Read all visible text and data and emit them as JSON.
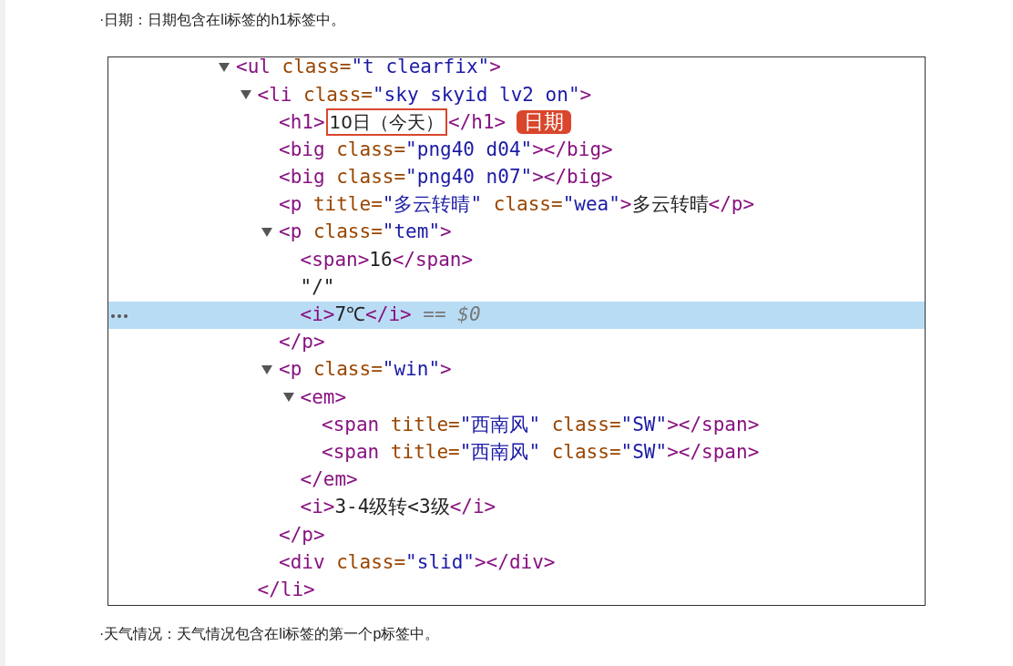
{
  "intro": "·日期：日期包含在li标签的h1标签中。",
  "tree": [
    {
      "expanded": true,
      "tokens": [
        {
          "kind": "tag",
          "text": "<ul"
        },
        {
          "kind": "attr",
          "text": " class="
        },
        {
          "kind": "value",
          "text": "\"t clearfix\""
        },
        {
          "kind": "tag",
          "text": ">"
        }
      ],
      "children": [
        {
          "expanded": true,
          "tokens": [
            {
              "kind": "tag",
              "text": "<li"
            },
            {
              "kind": "attr",
              "text": " class="
            },
            {
              "kind": "value",
              "text": "\"sky skyid lv2 on\""
            },
            {
              "kind": "tag",
              "text": ">"
            }
          ],
          "close": [
            {
              "kind": "tag",
              "text": "</li>"
            }
          ],
          "children": [
            {
              "tokens": [
                {
                  "kind": "tag",
                  "text": "<h1>"
                },
                {
                  "kind": "boxed",
                  "text": "10日（今天）"
                },
                {
                  "kind": "tag",
                  "text": "</h1>"
                },
                {
                  "kind": "badge",
                  "text": "日期"
                }
              ]
            },
            {
              "tokens": [
                {
                  "kind": "tag",
                  "text": "<big"
                },
                {
                  "kind": "attr",
                  "text": " class="
                },
                {
                  "kind": "value",
                  "text": "\"png40 d04\""
                },
                {
                  "kind": "tag",
                  "text": "></big>"
                }
              ]
            },
            {
              "tokens": [
                {
                  "kind": "tag",
                  "text": "<big"
                },
                {
                  "kind": "attr",
                  "text": " class="
                },
                {
                  "kind": "value",
                  "text": "\"png40 n07\""
                },
                {
                  "kind": "tag",
                  "text": "></big>"
                }
              ]
            },
            {
              "tokens": [
                {
                  "kind": "tag",
                  "text": "<p"
                },
                {
                  "kind": "attr",
                  "text": " title="
                },
                {
                  "kind": "value",
                  "text": "\"多云转晴\""
                },
                {
                  "kind": "attr",
                  "text": " class="
                },
                {
                  "kind": "value",
                  "text": "\"wea\""
                },
                {
                  "kind": "tag",
                  "text": ">"
                },
                {
                  "kind": "text",
                  "text": "多云转晴"
                },
                {
                  "kind": "tag",
                  "text": "</p>"
                }
              ]
            },
            {
              "expanded": true,
              "tokens": [
                {
                  "kind": "tag",
                  "text": "<p"
                },
                {
                  "kind": "attr",
                  "text": " class="
                },
                {
                  "kind": "value",
                  "text": "\"tem\""
                },
                {
                  "kind": "tag",
                  "text": ">"
                }
              ],
              "close": [
                {
                  "kind": "tag",
                  "text": "</p>"
                }
              ],
              "children": [
                {
                  "tokens": [
                    {
                      "kind": "tag",
                      "text": "<span>"
                    },
                    {
                      "kind": "text",
                      "text": "16"
                    },
                    {
                      "kind": "tag",
                      "text": "</span>"
                    }
                  ]
                },
                {
                  "tokens": [
                    {
                      "kind": "text",
                      "text": "\"/\""
                    }
                  ]
                },
                {
                  "selected": true,
                  "tokens": [
                    {
                      "kind": "tag",
                      "text": "<i>"
                    },
                    {
                      "kind": "text",
                      "text": "7℃"
                    },
                    {
                      "kind": "tag",
                      "text": "</i>"
                    },
                    {
                      "kind": "ref",
                      "text": " == $0"
                    }
                  ]
                }
              ]
            },
            {
              "expanded": true,
              "tokens": [
                {
                  "kind": "tag",
                  "text": "<p"
                },
                {
                  "kind": "attr",
                  "text": " class="
                },
                {
                  "kind": "value",
                  "text": "\"win\""
                },
                {
                  "kind": "tag",
                  "text": ">"
                }
              ],
              "close": [
                {
                  "kind": "tag",
                  "text": "</p>"
                }
              ],
              "children": [
                {
                  "expanded": true,
                  "tokens": [
                    {
                      "kind": "tag",
                      "text": "<em>"
                    }
                  ],
                  "close": [
                    {
                      "kind": "tag",
                      "text": "</em>"
                    }
                  ],
                  "children": [
                    {
                      "tokens": [
                        {
                          "kind": "tag",
                          "text": "<span"
                        },
                        {
                          "kind": "attr",
                          "text": " title="
                        },
                        {
                          "kind": "value",
                          "text": "\"西南风\""
                        },
                        {
                          "kind": "attr",
                          "text": " class="
                        },
                        {
                          "kind": "value",
                          "text": "\"SW\""
                        },
                        {
                          "kind": "tag",
                          "text": "></span>"
                        }
                      ]
                    },
                    {
                      "tokens": [
                        {
                          "kind": "tag",
                          "text": "<span"
                        },
                        {
                          "kind": "attr",
                          "text": " title="
                        },
                        {
                          "kind": "value",
                          "text": "\"西南风\""
                        },
                        {
                          "kind": "attr",
                          "text": " class="
                        },
                        {
                          "kind": "value",
                          "text": "\"SW\""
                        },
                        {
                          "kind": "tag",
                          "text": "></span>"
                        }
                      ]
                    }
                  ]
                },
                {
                  "tokens": [
                    {
                      "kind": "tag",
                      "text": "<i>"
                    },
                    {
                      "kind": "text",
                      "text": "3-4级转<3级"
                    },
                    {
                      "kind": "tag",
                      "text": "</i>"
                    }
                  ]
                }
              ]
            },
            {
              "tokens": [
                {
                  "kind": "tag",
                  "text": "<div"
                },
                {
                  "kind": "attr",
                  "text": " class="
                },
                {
                  "kind": "value",
                  "text": "\"slid\""
                },
                {
                  "kind": "tag",
                  "text": "></div>"
                }
              ]
            }
          ]
        }
      ]
    }
  ],
  "outro": "·天气情况：天气情况包含在li标签的第一个p标签中。"
}
